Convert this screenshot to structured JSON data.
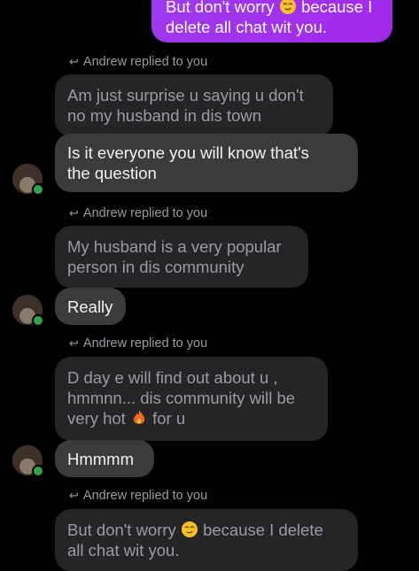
{
  "sent_top": {
    "line1_a": "But don't worry",
    "line1_b": "because I",
    "line2": "delete all chat wit you."
  },
  "replies": [
    {
      "label": "Andrew replied to you",
      "quoted": [
        "Am just surprise u saying u don't",
        "no my husband in dis town"
      ],
      "message": [
        "Is it everyone you will know that's",
        "the question"
      ]
    },
    {
      "label": "Andrew replied to you",
      "quoted": [
        "My husband is a very popular",
        "person in dis community"
      ],
      "message": [
        "Really"
      ]
    },
    {
      "label": "Andrew replied to you",
      "quoted": [
        "D day e will find out about u ,",
        "hmmnn... dis community will be",
        "very hot",
        "for u"
      ],
      "message": [
        "Hmmmm"
      ]
    },
    {
      "label": "Andrew replied to you",
      "quoted": [
        "But don't worry",
        "because I delete",
        "all chat wit you."
      ]
    }
  ],
  "icons": {
    "reply": "reply-arrow-icon",
    "emoji_smirk": "smirk-emoji-icon",
    "emoji_fire": "fire-emoji-icon",
    "avatar": "contact-avatar",
    "online": "online-status-dot"
  },
  "colors": {
    "background": "#000000",
    "sent_bubble": "#a228ea",
    "received_bubble": "#3a3b3c",
    "quoted_bubble": "#242526",
    "online": "#31a24c"
  }
}
